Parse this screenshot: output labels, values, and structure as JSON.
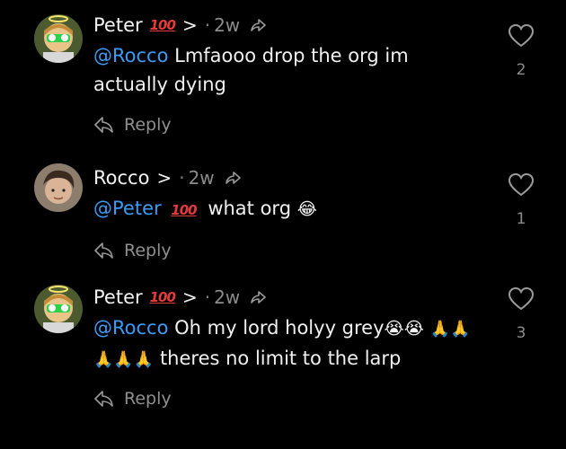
{
  "comments": [
    {
      "author": "Peter",
      "badge": "100",
      "chevron": ">",
      "dot": "·",
      "time": "2w",
      "mention": "@Rocco",
      "text": "Lmfaooo drop the org im actually dying",
      "reply_label": "Reply",
      "likes": "2",
      "avatar": "peter-avatar-icon"
    },
    {
      "author": "Rocco",
      "chevron": ">",
      "dot": "·",
      "time": "2w",
      "mention": "@Peter",
      "mention_badge": "100",
      "text": "what org",
      "emoji": "😂",
      "reply_label": "Reply",
      "likes": "1",
      "avatar": "rocco-avatar-icon"
    },
    {
      "author": "Peter",
      "badge": "100",
      "chevron": ">",
      "dot": "·",
      "time": "2w",
      "mention": "@Rocco",
      "text": "Oh my lord holyy grey",
      "emoji_after_text": "😭😭",
      "prayers": "🙏🙏🙏🙏🙏",
      "text_cont": "theres no limit to the larp",
      "reply_label": "Reply",
      "likes": "3",
      "avatar": "peter-avatar-icon"
    }
  ],
  "colors": {
    "background": "#000000",
    "mention": "#3d9bf7",
    "muted": "#8b8b8b",
    "badge": "#e43a3a"
  }
}
